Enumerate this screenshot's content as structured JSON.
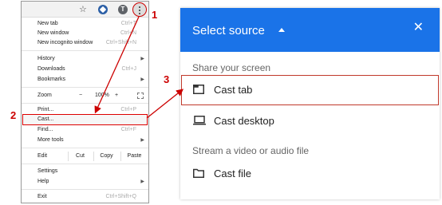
{
  "menu": {
    "items": {
      "new_tab": {
        "label": "New tab",
        "shortcut": "Ctrl+T"
      },
      "new_window": {
        "label": "New window",
        "shortcut": "Ctrl+N"
      },
      "new_incognito": {
        "label": "New incognito window",
        "shortcut": "Ctrl+Shift+N"
      },
      "history": {
        "label": "History"
      },
      "downloads": {
        "label": "Downloads",
        "shortcut": "Ctrl+J"
      },
      "bookmarks": {
        "label": "Bookmarks"
      },
      "zoom": {
        "label": "Zoom",
        "minus": "−",
        "value": "100%",
        "plus": "+"
      },
      "print": {
        "label": "Print...",
        "shortcut": "Ctrl+P"
      },
      "cast": {
        "label": "Cast..."
      },
      "find": {
        "label": "Find...",
        "shortcut": "Ctrl+F"
      },
      "more_tools": {
        "label": "More tools"
      },
      "edit": {
        "label": "Edit",
        "cut": "Cut",
        "copy": "Copy",
        "paste": "Paste"
      },
      "settings": {
        "label": "Settings"
      },
      "help": {
        "label": "Help"
      },
      "exit": {
        "label": "Exit",
        "shortcut": "Ctrl+Shift+Q"
      }
    },
    "avatar_letter": "T"
  },
  "dialog": {
    "title": "Select source",
    "share_screen_label": "Share your screen",
    "cast_tab": "Cast tab",
    "cast_desktop": "Cast desktop",
    "stream_label": "Stream a video or audio file",
    "cast_file": "Cast file",
    "header_color": "#1a73e8"
  },
  "annotations": {
    "step1": "1",
    "step2": "2",
    "step3": "3",
    "color": "#cc0000"
  }
}
